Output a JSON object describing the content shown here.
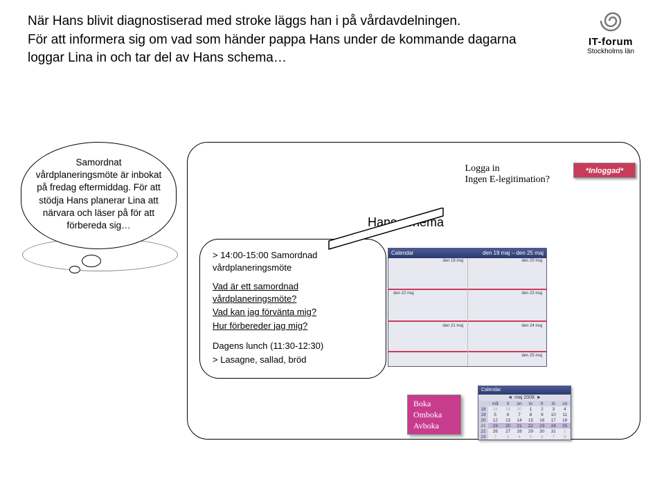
{
  "header": {
    "line1": "När Hans blivit diagnostiserad med stroke läggs han i på vårdavdelningen.",
    "line2": "För att informera sig om vad som händer pappa Hans under de kommande dagarna loggar Lina in och tar del av Hans schema…"
  },
  "logo": {
    "title": "IT-forum",
    "subtitle": "Stockholms län"
  },
  "bubble": {
    "text": "Samordnat vårdplaneringsmöte är inbokat på fredag eftermiddag. För att stödja Hans planerar Lina att närvara och läser på för att förbereda sig…"
  },
  "panel": {
    "title": "Hans schema",
    "login": {
      "login_text": "Logga in",
      "legit_text": "Ingen E-legitimation?"
    },
    "badge": "*Inloggad*"
  },
  "callout": {
    "line1": "> 14:00-15:00 Samordnad vårdplaneringsmöte",
    "q1": "Vad är ett samordnad vårdplaneringsmöte?",
    "q2": "Vad kan jag förvänta mig?",
    "q3": "Hur förbereder jag mig?",
    "lunch1": "Dagens lunch (11:30-12:30)",
    "lunch2": "> Lasagne, sallad, bröd"
  },
  "cal_week": {
    "title_left": "Calendar",
    "title_right": "den 19 maj – den 25 maj",
    "days": [
      "den 19 maj",
      "den 20 maj",
      "den 21 maj",
      "den 22 maj",
      "den 23 maj",
      "den 24 maj",
      "den 25 maj"
    ]
  },
  "book": {
    "l1": "Boka",
    "l2": "Omboka",
    "l3": "Avboka"
  },
  "cal_month": {
    "title": "Calendar",
    "month": "maj 2008",
    "dow": [
      "må",
      "ti",
      "on",
      "to",
      "fr",
      "lö",
      "sö"
    ],
    "weeks": [
      {
        "wk": "18",
        "d": [
          "28",
          "29",
          "30",
          "1",
          "2",
          "3",
          "4"
        ],
        "dim": [
          0,
          1,
          2
        ]
      },
      {
        "wk": "19",
        "d": [
          "5",
          "6",
          "7",
          "8",
          "9",
          "10",
          "11"
        ],
        "dim": []
      },
      {
        "wk": "20",
        "d": [
          "12",
          "13",
          "14",
          "15",
          "16",
          "17",
          "18"
        ],
        "dim": []
      },
      {
        "wk": "21",
        "d": [
          "19",
          "20",
          "21",
          "22",
          "23",
          "24",
          "25"
        ],
        "dim": [],
        "hl": true
      },
      {
        "wk": "22",
        "d": [
          "26",
          "27",
          "28",
          "29",
          "30",
          "31",
          "1"
        ],
        "dim": [
          6
        ]
      },
      {
        "wk": "23",
        "d": [
          "2",
          "3",
          "4",
          "5",
          "6",
          "7",
          "8"
        ],
        "dim": [
          0,
          1,
          2,
          3,
          4,
          5,
          6
        ]
      }
    ]
  }
}
